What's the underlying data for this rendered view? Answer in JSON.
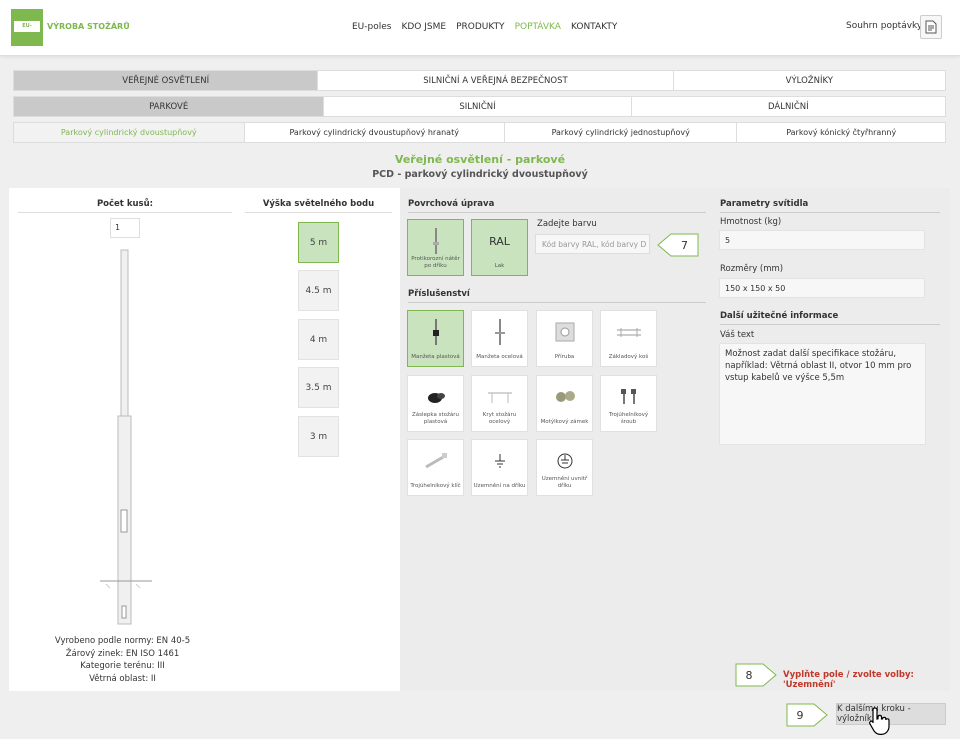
{
  "header": {
    "logo_text": "EU-POLES",
    "brand": "VÝROBA STOŽÁRŮ",
    "nav": [
      "EU-poles",
      "KDO JSME",
      "PRODUKTY",
      "POPTÁVKA",
      "KONTAKTY"
    ],
    "summary_label": "Souhrn poptávky:"
  },
  "tabs_row1": [
    "VEŘEJNÉ OSVĚTLENÍ",
    "SILNIČNÍ A VEŘEJNÁ BEZPEČNOST",
    "VÝLOŽNÍKY"
  ],
  "tabs_row2": [
    "PARKOVÉ",
    "SILNIČNÍ",
    "DÁLNIČNÍ"
  ],
  "tabs_row3": [
    "Parkový cylindrický dvoustupňový",
    "Parkový cylindrický dvoustupňový hranatý",
    "Parkový cylindrický jednostupňový",
    "Parkový kónický čtyřhranný"
  ],
  "title": "Veřejné osvětlení - parkové",
  "subtitle": "PCD - parkový cylindrický dvoustupňový",
  "left": {
    "qty_head": "Počet kusů:",
    "qty_value": "1",
    "height_head": "Výška světelného bodu",
    "heights": [
      "5 m",
      "4.5 m",
      "4 m",
      "3.5 m",
      "3 m"
    ],
    "info": [
      "Vyrobeno podle normy: EN 40-5",
      "Žárový zinek: EN ISO 1461",
      "Kategorie terénu: III",
      "Větrná oblast: II"
    ]
  },
  "surface": {
    "head": "Povrchová úprava",
    "tiles": [
      {
        "label": "Protikorozní nátěr po dříku",
        "icon": "pole-coating-icon"
      },
      {
        "label": "Lak",
        "icon_text": "RAL"
      }
    ],
    "ral_label": "Zadejte barvu",
    "ral_placeholder": "Kód barvy RAL, kód barvy D"
  },
  "accessories": {
    "head": "Příslušenství",
    "tiles": [
      {
        "label": "Manžeta plastová",
        "icon": "plastic-sleeve-icon"
      },
      {
        "label": "Manžeta ocelová",
        "icon": "steel-sleeve-icon"
      },
      {
        "label": "Příruba",
        "icon": "flange-icon"
      },
      {
        "label": "Základový koš",
        "icon": "foundation-basket-icon"
      },
      {
        "label": "Záslepka stožáru plastová",
        "icon": "plastic-cap-icon"
      },
      {
        "label": "Kryt stožáru ocelový",
        "icon": "steel-cover-icon"
      },
      {
        "label": "Motýlkový zámek",
        "icon": "butterfly-lock-icon"
      },
      {
        "label": "Trojúhelníkový šroub",
        "icon": "triangle-screw-icon"
      },
      {
        "label": "Trojúhelníkový klíč",
        "icon": "triangle-key-icon"
      },
      {
        "label": "Uzemnění na dříku",
        "icon": "ground-icon"
      },
      {
        "label": "Uzemnění uvnitř dříku",
        "icon": "ground-inside-icon"
      }
    ]
  },
  "params": {
    "head": "Parametry svítidla",
    "weight_label": "Hmotnost (kg)",
    "weight_value": "5",
    "dims_label": "Rozměry (mm)",
    "dims_value": "150 x 150 x 50",
    "extra_head": "Další užitečné informace",
    "text_label": "Váš text",
    "text_value": "Možnost zadat další specifikace stožáru, například: Větrná oblast II, otvor 10 mm pro vstup kabelů ve výšce 5,5m"
  },
  "callouts": [
    "7",
    "8",
    "9"
  ],
  "warning": "Vyplňte pole / zvolte volby: 'Uzemnění'",
  "next_button": "K dalšímu kroku - výložník",
  "colors": {
    "accent": "#7fb84e",
    "warning": "#c0392b",
    "selected_bg": "#c8e3bd"
  }
}
